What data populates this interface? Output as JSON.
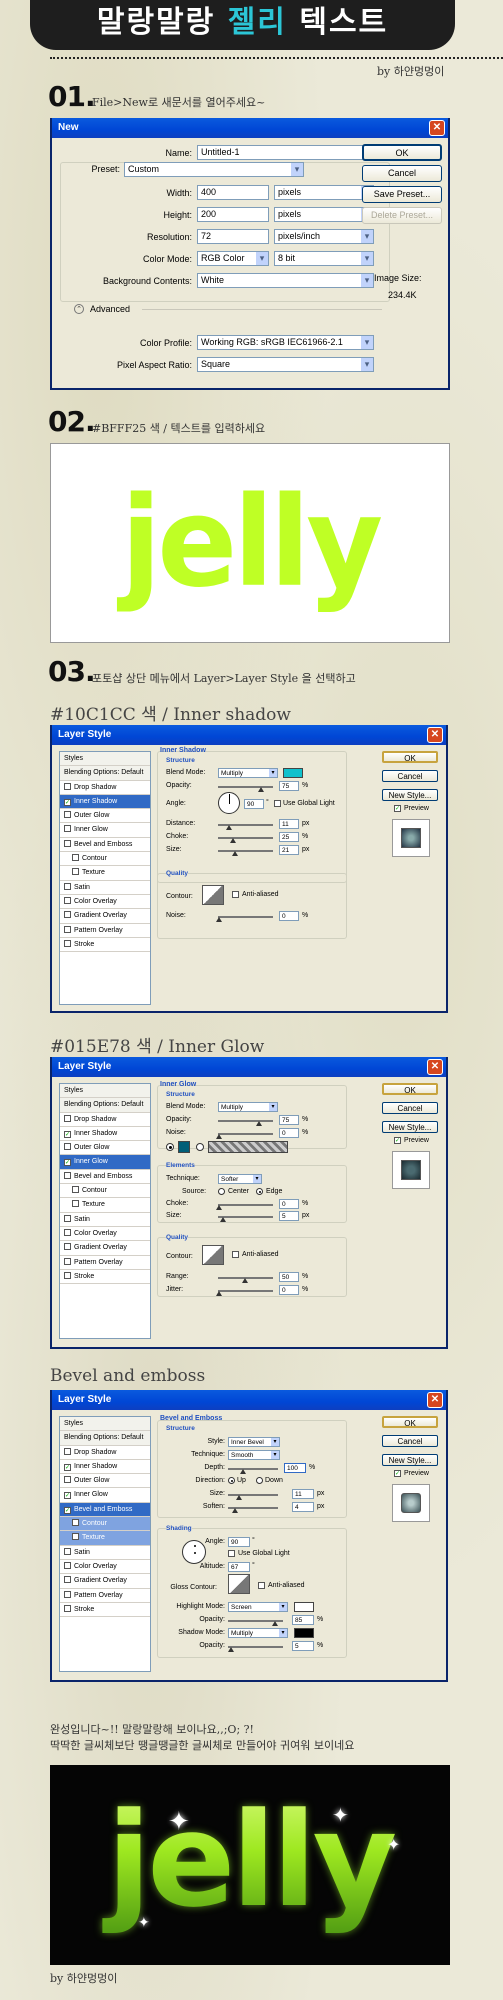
{
  "header": {
    "title_a": "말랑말랑 ",
    "title_b": "젤리",
    "title_c": " 텍스트",
    "byline": "by 하얀멍멍이"
  },
  "step1": {
    "num": "01.",
    "caption": "File>New로 새문서를 열어주세요~"
  },
  "new_dialog": {
    "title": "New",
    "name_label": "Name:",
    "name_value": "Untitled-1",
    "preset_label": "Preset:",
    "preset_value": "Custom",
    "width_label": "Width:",
    "width_value": "400",
    "width_unit": "pixels",
    "height_label": "Height:",
    "height_value": "200",
    "height_unit": "pixels",
    "resolution_label": "Resolution:",
    "resolution_value": "72",
    "resolution_unit": "pixels/inch",
    "colormode_label": "Color Mode:",
    "colormode_value": "RGB Color",
    "colormode_bits": "8 bit",
    "bg_label": "Background Contents:",
    "bg_value": "White",
    "advanced_label": "Advanced",
    "profile_label": "Color Profile:",
    "profile_value": "Working RGB:  sRGB IEC61966-2.1",
    "aspect_label": "Pixel Aspect Ratio:",
    "aspect_value": "Square",
    "ok": "OK",
    "cancel": "Cancel",
    "save_preset": "Save Preset...",
    "delete_preset": "Delete Preset...",
    "image_size_label": "Image Size:",
    "image_size_value": "234.4K"
  },
  "step2": {
    "num": "02.",
    "caption": "#BFFF25 색 / 텍스트를 입력하세요",
    "word": "jelly"
  },
  "step3": {
    "num": "03.",
    "caption": "포토샵 상단 메뉴에서 Layer>Layer Style 을 선택하고"
  },
  "inner_shadow": {
    "heading": "#10C1CC 색 / Inner shadow",
    "title": "Layer Style",
    "list": [
      "Styles",
      "Blending Options: Default",
      "Drop Shadow",
      "Inner Shadow",
      "Outer Glow",
      "Inner Glow",
      "Bevel and Emboss",
      "Contour",
      "Texture",
      "Satin",
      "Color Overlay",
      "Gradient Overlay",
      "Pattern Overlay",
      "Stroke"
    ],
    "section": "Inner Shadow",
    "structure": "Structure",
    "blend_label": "Blend Mode:",
    "blend_value": "Multiply",
    "color": "#10C1CC",
    "opacity_label": "Opacity:",
    "opacity_value": "75",
    "angle_label": "Angle:",
    "angle_value": "90",
    "global_light": "Use Global Light",
    "distance_label": "Distance:",
    "distance_value": "11",
    "choke_label": "Choke:",
    "choke_value": "25",
    "size_label": "Size:",
    "size_value": "21",
    "quality": "Quality",
    "contour_label": "Contour:",
    "antialias": "Anti-aliased",
    "noise_label": "Noise:",
    "noise_value": "0",
    "ok": "OK",
    "cancel": "Cancel",
    "new_style": "New Style...",
    "preview": "Preview",
    "px": "px",
    "pct": "%",
    "deg": "°"
  },
  "inner_glow": {
    "heading": "#015E78 색 / Inner Glow",
    "title": "Layer Style",
    "list": [
      "Styles",
      "Blending Options: Default",
      "Drop Shadow",
      "Inner Shadow",
      "Outer Glow",
      "Inner Glow",
      "Bevel and Emboss",
      "Contour",
      "Texture",
      "Satin",
      "Color Overlay",
      "Gradient Overlay",
      "Pattern Overlay",
      "Stroke"
    ],
    "section": "Inner Glow",
    "structure": "Structure",
    "blend_label": "Blend Mode:",
    "blend_value": "Multiply",
    "opacity_label": "Opacity:",
    "opacity_value": "75",
    "noise_label": "Noise:",
    "noise_value": "0",
    "color": "#015E78",
    "elements": "Elements",
    "technique_label": "Technique:",
    "technique_value": "Softer",
    "source_label": "Source:",
    "center": "Center",
    "edge": "Edge",
    "choke_label": "Choke:",
    "choke_value": "0",
    "size_label": "Size:",
    "size_value": "5",
    "quality": "Quality",
    "contour_label": "Contour:",
    "antialias": "Anti-aliased",
    "range_label": "Range:",
    "range_value": "50",
    "jitter_label": "Jitter:",
    "jitter_value": "0",
    "ok": "OK",
    "cancel": "Cancel",
    "new_style": "New Style...",
    "preview": "Preview",
    "px": "px",
    "pct": "%"
  },
  "bevel": {
    "heading": "Bevel and emboss",
    "title": "Layer Style",
    "list": [
      "Styles",
      "Blending Options: Default",
      "Drop Shadow",
      "Inner Shadow",
      "Outer Glow",
      "Inner Glow",
      "Bevel and Emboss",
      "Contour",
      "Texture",
      "Satin",
      "Color Overlay",
      "Gradient Overlay",
      "Pattern Overlay",
      "Stroke"
    ],
    "section": "Bevel and Emboss",
    "structure": "Structure",
    "style_label": "Style:",
    "style_value": "Inner Bevel",
    "technique_label": "Technique:",
    "technique_value": "Smooth",
    "depth_label": "Depth:",
    "depth_value": "100",
    "direction_label": "Direction:",
    "up": "Up",
    "down": "Down",
    "size_label": "Size:",
    "size_value": "11",
    "soften_label": "Soften:",
    "soften_value": "4",
    "shading": "Shading",
    "angle_label": "Angle:",
    "angle_value": "90",
    "global_light": "Use Global Light",
    "altitude_label": "Altitude:",
    "altitude_value": "67",
    "gloss_label": "Gloss Contour:",
    "antialias": "Anti-aliased",
    "highlight_label": "Highlight Mode:",
    "highlight_value": "Screen",
    "h_opacity_label": "Opacity:",
    "h_opacity_value": "85",
    "shadow_label": "Shadow Mode:",
    "shadow_value": "Multiply",
    "s_opacity_label": "Opacity:",
    "s_opacity_value": "5",
    "ok": "OK",
    "cancel": "Cancel",
    "new_style": "New Style...",
    "preview": "Preview",
    "px": "px",
    "pct": "%",
    "deg": "°"
  },
  "final": {
    "line1": "완성입니다~!! 말랑말랑해 보이나요,,;O; ?!",
    "line2": "딱딱한 글씨체보단 땡글땡글한 글씨체로 만들어야 귀여워 보이네요",
    "word": "jelly",
    "byline": "by 하얀멍멍이"
  }
}
